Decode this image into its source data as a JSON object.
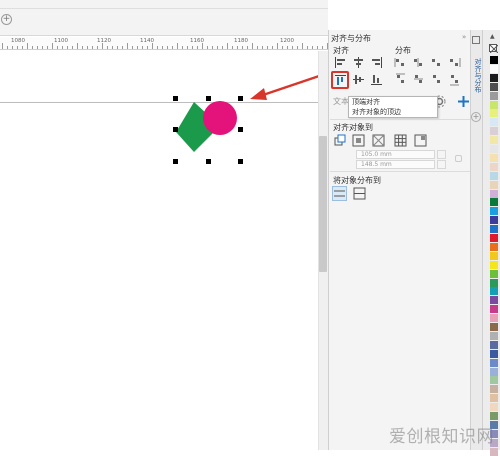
{
  "ruler": {
    "labels": [
      "1080",
      "1100",
      "1120",
      "1140",
      "1160",
      "1180",
      "1200"
    ]
  },
  "docker": {
    "title": "对齐与分布",
    "tab_label": "对齐与分布",
    "sections": {
      "align": "对齐",
      "distribute": "分布",
      "text": "文本",
      "align_objects_to": "对齐对象到",
      "distribute_objects_to": "将对象分布到"
    },
    "tooltip": {
      "title": "顶端对齐",
      "description": "对齐对象的顶边"
    },
    "fields": {
      "x": "105.0 mm",
      "y": "148.5 mm"
    }
  },
  "colors": {
    "arrow": "#d9362b",
    "highlight": "#d9362b",
    "diamond": "#1a9a4a",
    "circle": "#e4127b",
    "accent": "#1e73c8"
  },
  "palette": [
    "#000000",
    "#ffffff",
    "#1d1d1d",
    "#4d4d4d",
    "#9b9b9b",
    "#c8e66a",
    "#e6f07a",
    "#d6e8f4",
    "#d8d0d6",
    "#f1e7a6",
    "#e6e6e6",
    "#f5e0b0",
    "#ecd6c8",
    "#b8d8e6",
    "#e8d4b8",
    "#d0b0d6",
    "#0a7a3a",
    "#1aa0e0",
    "#3c3c9c",
    "#1e73c8",
    "#e01a2a",
    "#e8701a",
    "#f2c81a",
    "#f5e61a",
    "#6bbf3a",
    "#2a9a5a",
    "#14a0b4",
    "#7a4aa0",
    "#c83a8a",
    "#e8a0b8",
    "#8a6a4a",
    "#b0b0b0",
    "#5a6aa0",
    "#3a5aa0",
    "#6a8ac8",
    "#9ab0d8",
    "#a0c8a0",
    "#c8b0a0",
    "#e0c0a0",
    "#f0d8c0",
    "#7a9a6a",
    "#5a7aa8",
    "#8a8ab8",
    "#b8a8c8",
    "#d8b8c0"
  ],
  "watermark": "爱创根知识网"
}
